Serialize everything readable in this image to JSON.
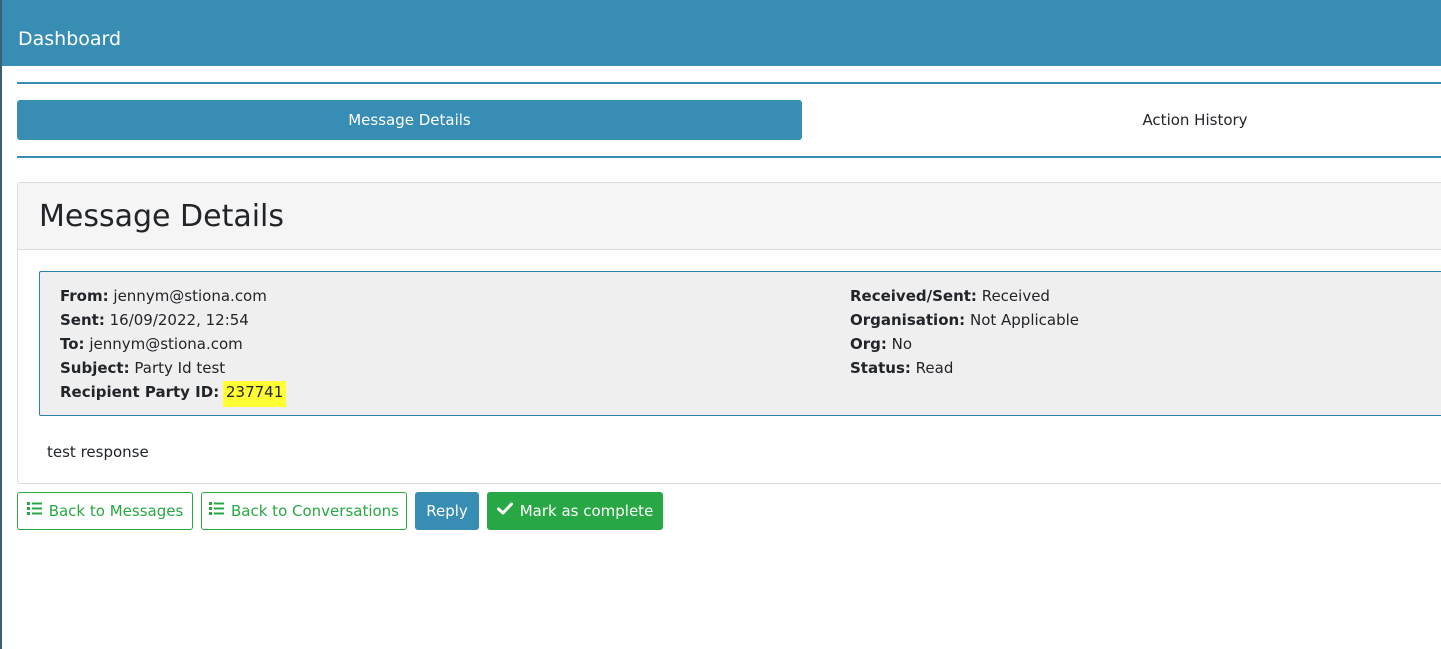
{
  "header": {
    "title": "Dashboard",
    "background_color": "#378db4"
  },
  "tabs": [
    {
      "label": "Message Details",
      "active": true
    },
    {
      "label": "Action History",
      "active": false
    }
  ],
  "card": {
    "title": "Message Details",
    "left_fields": [
      {
        "label": "From:",
        "value": "jennym@stiona.com"
      },
      {
        "label": "Sent:",
        "value": "16/09/2022, 12:54"
      },
      {
        "label": "To:",
        "value": "jennym@stiona.com"
      },
      {
        "label": "Subject:",
        "value": "Party Id test"
      },
      {
        "label": "Recipient Party ID:",
        "value": "237741",
        "highlighted": true
      }
    ],
    "right_fields": [
      {
        "label": "Received/Sent:",
        "value": "Received"
      },
      {
        "label": "Organisation:",
        "value": "Not Applicable"
      },
      {
        "label": "Org:",
        "value": "No"
      },
      {
        "label": "Status:",
        "value": "Read"
      }
    ],
    "body": "test response"
  },
  "buttons": {
    "back_to_messages": {
      "label": "Back to Messages",
      "icon": "list-icon"
    },
    "back_to_conversations": {
      "label": "Back to Conversations",
      "icon": "list-icon"
    },
    "reply": {
      "label": "Reply"
    },
    "mark_complete": {
      "label": "Mark as complete",
      "icon": "check-icon"
    }
  },
  "colors": {
    "primary": "#378db4",
    "success": "#28a745",
    "highlight": "#ffff33"
  }
}
